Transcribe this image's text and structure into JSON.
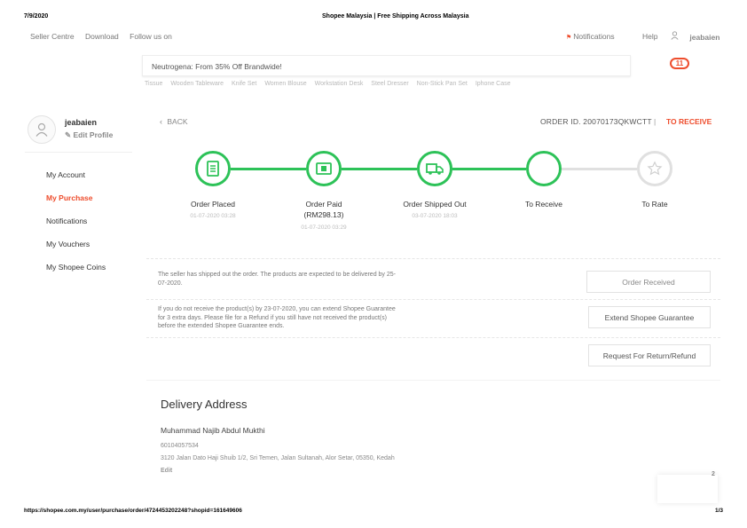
{
  "print_header": {
    "date": "7/9/2020",
    "title": "Shopee Malaysia | Free Shipping Across Malaysia"
  },
  "topnav": {
    "left": [
      "Seller Centre",
      "Download",
      "Follow us on"
    ],
    "notifications": "Notifications",
    "help": "Help",
    "username": "jeabaien"
  },
  "search": {
    "placeholder": "Neutrogena: From 35% Off Brandwide!",
    "suggestions": [
      "Tissue",
      "Wooden Tableware",
      "Knife Set",
      "Women Blouse",
      "Workstation Desk",
      "Steel Dresser",
      "Non-Stick Pan Set",
      "Iphone Case"
    ],
    "cart_count": "11"
  },
  "sidebar": {
    "username": "jeabaien",
    "edit_profile": "Edit Profile",
    "items": [
      {
        "label": "My Account",
        "active": false
      },
      {
        "label": "My Purchase",
        "active": true
      },
      {
        "label": "Notifications",
        "active": false
      },
      {
        "label": "My Vouchers",
        "active": false
      },
      {
        "label": "My Shopee Coins",
        "active": false
      }
    ]
  },
  "order": {
    "back": "BACK",
    "order_id": "ORDER ID. 20070173QKWCTT",
    "separator": "|",
    "status": "TO RECEIVE",
    "steps": [
      {
        "label": "Order Placed",
        "sub": "",
        "date": "01-07-2020 03:28",
        "icon": "receipt-icon",
        "state": "done"
      },
      {
        "label": "Order Paid",
        "sub": "(RM298.13)",
        "date": "01-07-2020 03:29",
        "icon": "money-icon",
        "state": "done"
      },
      {
        "label": "Order Shipped Out",
        "sub": "",
        "date": "03-07-2020 18:03",
        "icon": "truck-icon",
        "state": "done"
      },
      {
        "label": "To Receive",
        "sub": "",
        "date": "",
        "icon": "",
        "state": "current"
      },
      {
        "label": "To Rate",
        "sub": "",
        "date": "",
        "icon": "star-icon",
        "state": "pending"
      }
    ],
    "shipped_note": "The seller has shipped out the order. The products are expected to be delivered by 25-07-2020.",
    "order_received_btn": "Order Received",
    "guarantee_note": "If you do not receive the product(s) by 23-07-2020, you can extend Shopee Guarantee for 3 extra days. Please file for a Refund if you still have not received the product(s) before the extended Shopee Guarantee ends.",
    "extend_btn": "Extend Shopee Guarantee",
    "refund_btn": "Request For Return/Refund"
  },
  "delivery": {
    "title": "Delivery Address",
    "name": "Muhammad Najib Abdul Mukthi",
    "phone": "60104057534",
    "address": "3120 Jalan Dato Haji Shuib 1/2, Sri Temen, Jalan Sultanah, Alor Setar, 05350, Kedah",
    "edit": "Edit"
  },
  "print_footer": {
    "url": "https://shopee.com.my/user/purchase/order/4724453202248?shopid=161649606",
    "page": "1/3"
  },
  "chat_count": "2",
  "colors": {
    "brand": "#ee4d2d",
    "success": "#2dc258",
    "muted": "#e0e0e0"
  }
}
